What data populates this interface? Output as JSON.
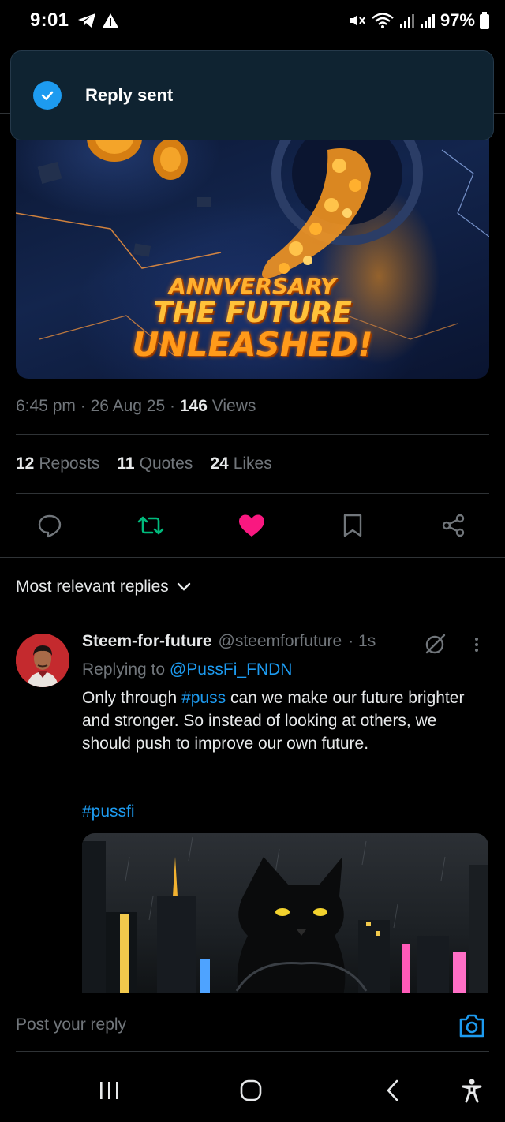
{
  "status_bar": {
    "time": "9:01",
    "battery": "97%"
  },
  "toast": {
    "text": "Reply sent"
  },
  "hero": {
    "line1": "ANNVERSARY",
    "line2": "THE FUTURE",
    "line3": "UNLEASHED!"
  },
  "post_meta": {
    "time": "6:45 pm",
    "date": "26 Aug 25",
    "views_count": "146",
    "views_label": "Views",
    "separator": "·"
  },
  "stats": [
    {
      "count": "12",
      "label": "Reposts"
    },
    {
      "count": "11",
      "label": "Quotes"
    },
    {
      "count": "24",
      "label": "Likes"
    }
  ],
  "actions": [
    "reply-icon",
    "repost-icon",
    "like-icon",
    "bookmark-icon",
    "share-icon"
  ],
  "colors": {
    "accent": "#1d9bf0",
    "like": "#f91880",
    "repost": "#00ba7c",
    "toast_bg": "#0f2331"
  },
  "replies": {
    "filter_label": "Most relevant replies",
    "items": [
      {
        "name": "Steem-for-future",
        "handle": "@steemforfuture",
        "time": "· 1s",
        "replying_prefix": "Replying to",
        "replying_to": "@PussFi_FNDN",
        "body_1": "Only through ",
        "body_tag": "#puss",
        "body_2": " can we make our future brighter and stronger. So instead of looking at others, we should push to improve our own future.",
        "tag2": "#pussfi"
      }
    ]
  },
  "composer": {
    "placeholder": "Post your reply"
  }
}
